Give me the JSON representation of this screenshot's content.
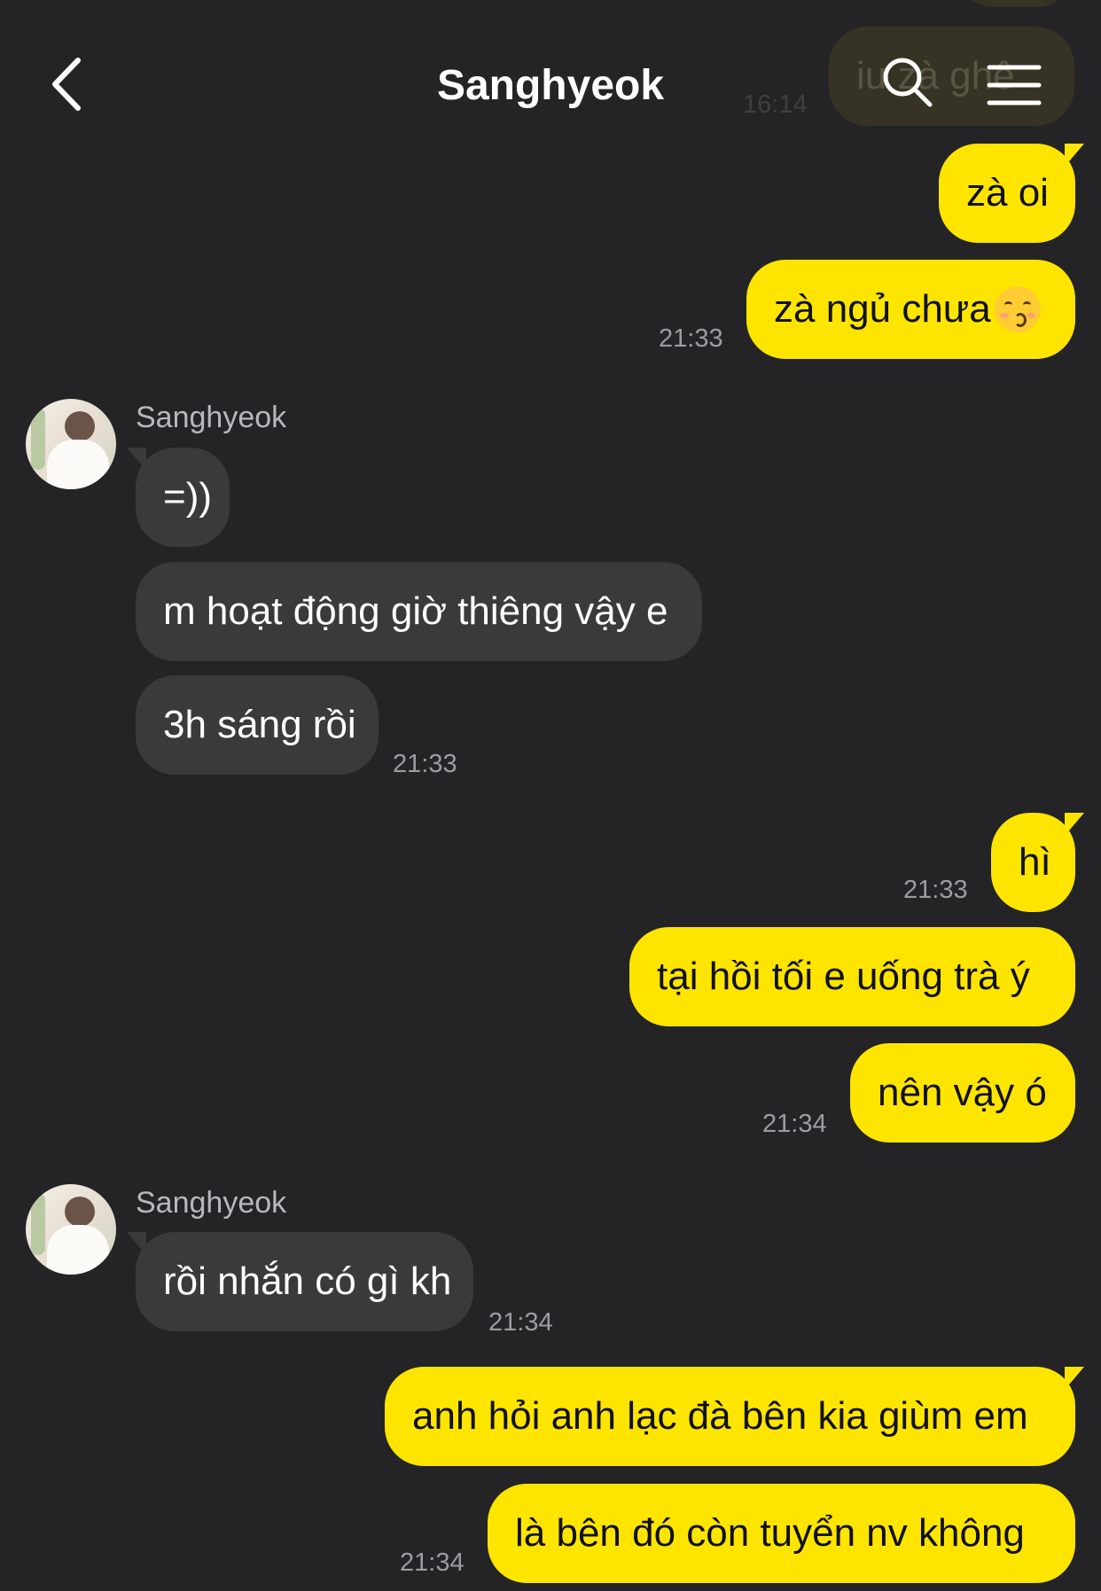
{
  "header": {
    "title": "Sanghyeok",
    "back_icon": "chevron-left-icon",
    "search_icon": "search-icon",
    "menu_icon": "hamburger-menu-icon"
  },
  "colors": {
    "background": "#242426",
    "sent_bubble": "#fee500",
    "received_bubble": "#3a3a3c",
    "timestamp": "#9c9ca1"
  },
  "ghost": {
    "text": "iu zà ghê",
    "time": "16:14"
  },
  "messages": [
    {
      "direction": "sent",
      "text": "zà oi",
      "time": ""
    },
    {
      "direction": "sent",
      "text": "zà ngủ chưa",
      "emoji": "kissing-face-emoji",
      "time": "21:33"
    },
    {
      "direction": "received",
      "sender": "Sanghyeok",
      "text": "=))",
      "time": ""
    },
    {
      "direction": "received",
      "text": "m hoạt động giờ thiêng vậy e",
      "time": ""
    },
    {
      "direction": "received",
      "text": "3h sáng rồi",
      "time": "21:33"
    },
    {
      "direction": "sent",
      "text": "hì",
      "time": "21:33"
    },
    {
      "direction": "sent",
      "text": "tại hồi tối e uống trà ý",
      "time": ""
    },
    {
      "direction": "sent",
      "text": "nên vậy ó",
      "time": "21:34"
    },
    {
      "direction": "received",
      "sender": "Sanghyeok",
      "text": "rồi nhắn có gì kh",
      "time": "21:34"
    },
    {
      "direction": "sent",
      "text": "anh hỏi anh lạc đà bên kia giùm em",
      "time": ""
    },
    {
      "direction": "sent",
      "text": "là bên đó còn tuyển nv không",
      "time": "21:34"
    }
  ]
}
